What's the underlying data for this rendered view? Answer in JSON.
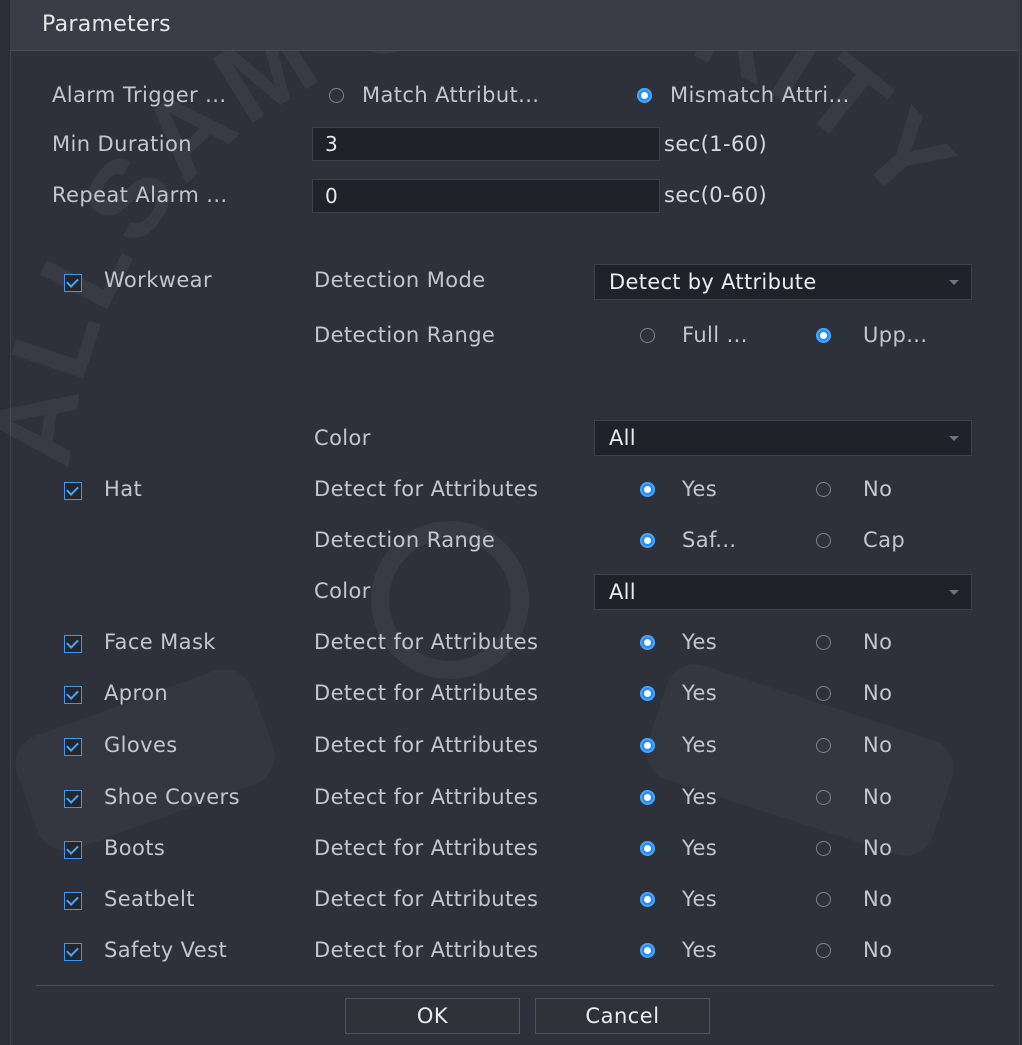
{
  "window": {
    "title": "Parameters"
  },
  "general": {
    "alarm_trigger": {
      "label": "Alarm Trigger ...",
      "options": [
        "Match Attribut...",
        "Mismatch Attri..."
      ],
      "selected": 1
    },
    "min_duration": {
      "label": "Min Duration",
      "value": "3",
      "unit": "sec(1-60)"
    },
    "repeat_alarm": {
      "label": "Repeat Alarm ...",
      "value": "0",
      "unit": "sec(0-60)"
    }
  },
  "workwear": {
    "name": "Workwear",
    "detection_mode_label": "Detection Mode",
    "detection_mode_value": "Detect by Attribute",
    "detection_range_label": "Detection Range",
    "range_options": [
      "Full ...",
      "Upp..."
    ],
    "range_selected": 1,
    "color_label": "Color",
    "color_value": "All"
  },
  "hat": {
    "name": "Hat",
    "detect_label": "Detect for Attributes",
    "yes": "Yes",
    "no": "No",
    "detection_range_label": "Detection Range",
    "range_options": [
      "Saf...",
      "Cap"
    ],
    "range_selected": 0,
    "color_label": "Color",
    "color_value": "All"
  },
  "attributes": [
    {
      "name": "Face Mask",
      "label": "Detect for Attributes",
      "yes": "Yes",
      "no": "No"
    },
    {
      "name": "Apron",
      "label": "Detect for Attributes",
      "yes": "Yes",
      "no": "No"
    },
    {
      "name": "Gloves",
      "label": "Detect for Attributes",
      "yes": "Yes",
      "no": "No"
    },
    {
      "name": "Shoe Covers",
      "label": "Detect for Attributes",
      "yes": "Yes",
      "no": "No"
    },
    {
      "name": "Boots",
      "label": "Detect for Attributes",
      "yes": "Yes",
      "no": "No"
    },
    {
      "name": "Seatbelt",
      "label": "Detect for Attributes",
      "yes": "Yes",
      "no": "No"
    },
    {
      "name": "Safety Vest",
      "label": "Detect for Attributes",
      "yes": "Yes",
      "no": "No"
    }
  ],
  "buttons": {
    "ok": "OK",
    "cancel": "Cancel"
  },
  "watermark": {
    "text": "ALLSAM SECURITY"
  },
  "colors": {
    "accent": "#1e8df5",
    "panel": "#2e3139",
    "titlebar": "#3a3d45"
  }
}
